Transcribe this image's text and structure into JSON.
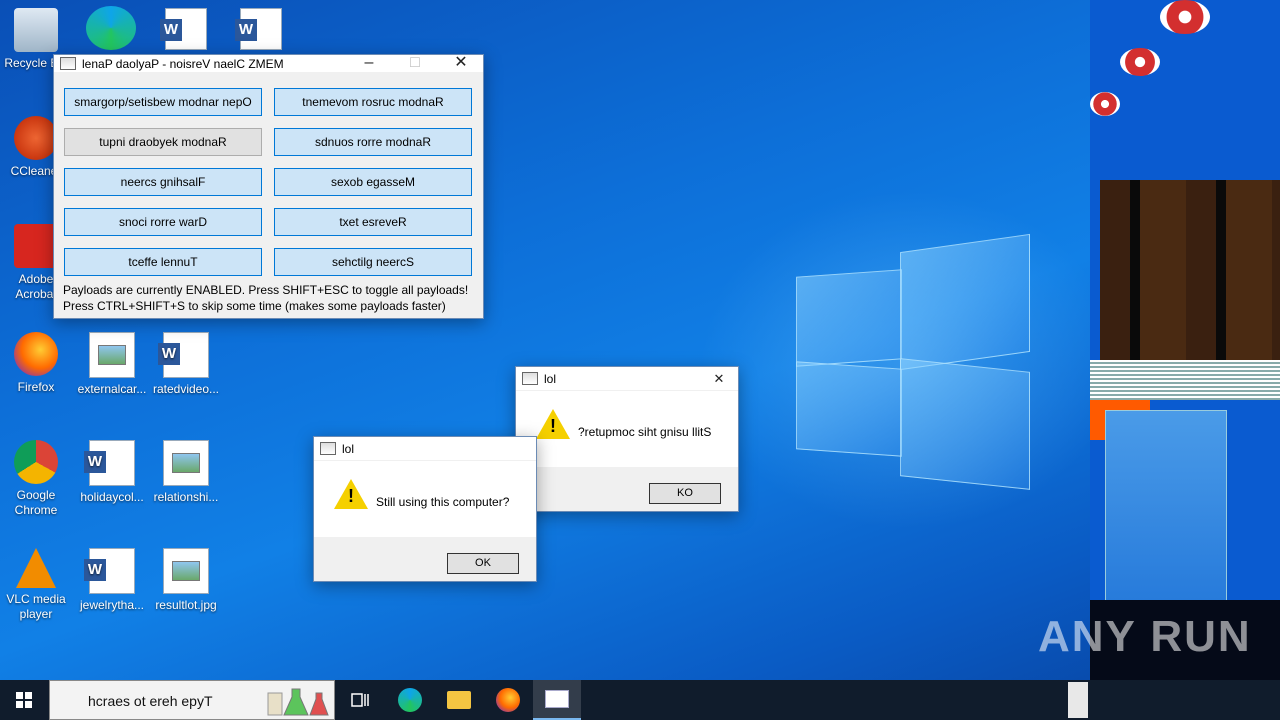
{
  "desktop": {
    "icons": [
      {
        "label": "Recycle Bin"
      },
      {
        "label": "CCleaner"
      },
      {
        "label": "Adobe Acrobat"
      },
      {
        "label": "Firefox"
      },
      {
        "label": "externalcar..."
      },
      {
        "label": "ratedvideo..."
      },
      {
        "label": "Google Chrome"
      },
      {
        "label": "holidaycol..."
      },
      {
        "label": "relationshi..."
      },
      {
        "label": "VLC media player"
      },
      {
        "label": "jewelrytha..."
      },
      {
        "label": "resultlot.jpg"
      }
    ]
  },
  "panel": {
    "title": "lenaP daolyaP - noisreV naelC ZMEM",
    "buttons": [
      "smargorp/setisbew modnar nepO",
      "tnemevom rosruc modnaR",
      "tupni draobyek modnaR",
      "sdnuos rorre modnaR",
      "neercs gnihsalF",
      "sexob egasseM",
      "snoci rorre warD",
      "txet esreveR",
      "tceffe lennuT",
      "sehctilg neercS"
    ],
    "status_line1": "Payloads are currently ENABLED. Press SHIFT+ESC to toggle all payloads!",
    "status_line2": "Press CTRL+SHIFT+S to skip some time (makes some payloads faster)"
  },
  "dialog_front": {
    "title": "lol",
    "message": "Still using this computer?",
    "ok_label": "OK"
  },
  "dialog_back": {
    "title": "lol",
    "message": "?retupmoc siht gnisu llitS",
    "ok_label": "KO"
  },
  "taskbar": {
    "search_text": "hcraes ot ereh epyT"
  },
  "watermark": "ANY RUN"
}
